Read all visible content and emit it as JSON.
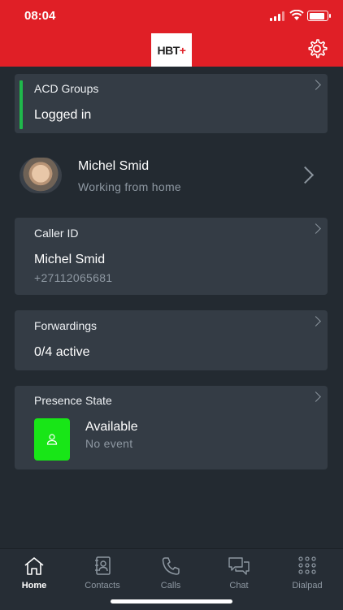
{
  "status_bar": {
    "time": "08:04"
  },
  "header": {
    "logo_text": "HBT",
    "logo_plus": "+",
    "settings_icon": "gear-icon",
    "accent_color": "#e01f26"
  },
  "acd": {
    "title": "ACD Groups",
    "value": "Logged in",
    "indicator_color": "#1fb84b"
  },
  "profile": {
    "name": "Michel Smid",
    "status": "Working from home"
  },
  "caller_id": {
    "title": "Caller ID",
    "name": "Michel Smid",
    "number": "+27112065681"
  },
  "forwardings": {
    "title": "Forwardings",
    "value": "0/4 active"
  },
  "presence": {
    "title": "Presence State",
    "state": "Available",
    "event": "No event",
    "state_color": "#18e617"
  },
  "tabs": [
    {
      "label": "Home",
      "icon": "home-icon",
      "active": true
    },
    {
      "label": "Contacts",
      "icon": "contacts-icon",
      "active": false
    },
    {
      "label": "Calls",
      "icon": "phone-icon",
      "active": false
    },
    {
      "label": "Chat",
      "icon": "chat-icon",
      "active": false
    },
    {
      "label": "Dialpad",
      "icon": "dialpad-icon",
      "active": false
    }
  ]
}
